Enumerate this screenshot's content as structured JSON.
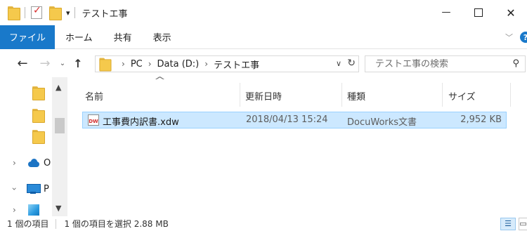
{
  "window": {
    "title": "テストエ事",
    "controls": {
      "minimize": "—",
      "maximize": "",
      "close": "✕"
    }
  },
  "ribbon": {
    "file_tab": "ファイル",
    "tabs": [
      "ホーム",
      "共有",
      "表示"
    ],
    "collapse_glyph": "﹀",
    "help_glyph": "?"
  },
  "address": {
    "crumbs": [
      "PC",
      "Data (D:)",
      "テストエ事"
    ],
    "separator": "›"
  },
  "search": {
    "placeholder": "テストエ事の検索"
  },
  "nav_pane": {
    "items": [
      {
        "label": "",
        "icon": "folder-icon"
      },
      {
        "label": "",
        "icon": "folder-icon"
      },
      {
        "label": "",
        "icon": "folder-icon"
      },
      {
        "label": "O",
        "icon": "onedrive-icon"
      },
      {
        "label": "P",
        "icon": "this-pc-icon"
      },
      {
        "label": "",
        "icon": "3d-objects-icon"
      }
    ]
  },
  "columns": {
    "name": "名前",
    "modified": "更新日時",
    "type": "種類",
    "size": "サイズ"
  },
  "files": [
    {
      "name": "工事費内訳書.xdw",
      "modified": "2018/04/13 15:24",
      "type": "DocuWorks文書",
      "size": "2,952 KB",
      "icon_text": "DW",
      "selected": true
    }
  ],
  "status": {
    "item_count": "1 個の項目",
    "selection": "1 個の項目を選択  2.88 MB"
  },
  "colors": {
    "accent": "#1979ca",
    "selection_fill": "#cce8ff",
    "selection_border": "#99d1ff",
    "folder": "#f5c94c"
  }
}
